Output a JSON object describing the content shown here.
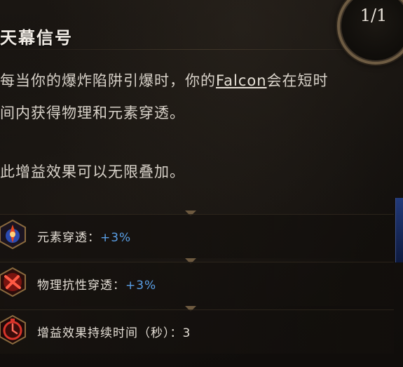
{
  "tooltip": {
    "title": "天幕信号",
    "counter": "1/1",
    "description": {
      "line1_pre": "每当你的爆炸陷阱引爆时，你的",
      "line1_link": "Falcon",
      "line1_post": "会在短时",
      "line2": "间内获得物理和元素穿透。",
      "line3": "此增益效果可以无限叠加。"
    },
    "stats": [
      {
        "label": "元素穿透：",
        "value": "+3%",
        "icon": "elemental-burst-icon"
      },
      {
        "label": "物理抗性穿透：",
        "value": "+3%",
        "icon": "physical-slash-icon"
      },
      {
        "label": "增益效果持续时间（秒）：3",
        "value": "",
        "icon": "stopwatch-icon"
      }
    ]
  },
  "colors": {
    "stat_value": "#5a9fe6",
    "title": "#f2ede6",
    "body_text": "#d8d2c9",
    "frame_gold": "#6e5c43"
  }
}
